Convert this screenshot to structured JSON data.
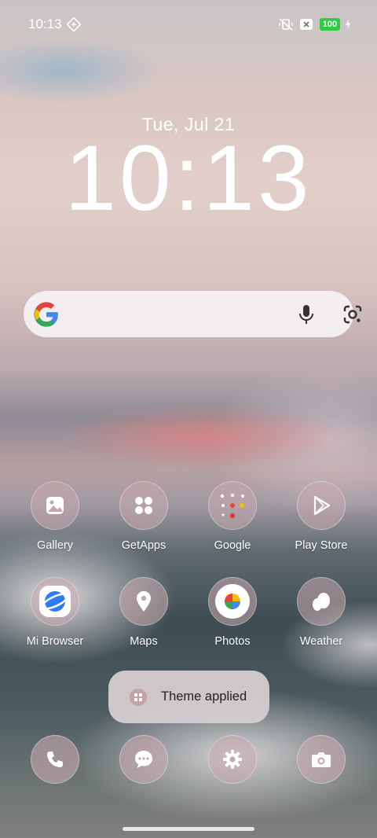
{
  "statusbar": {
    "time": "10:13",
    "battery": "100",
    "icons": [
      "data-saver-icon",
      "mute-icon",
      "sim-x-icon",
      "charging-icon"
    ],
    "battery_color": "#2ecc40"
  },
  "lockscreen": {
    "date": "Tue, Jul 21",
    "clock": "10:13"
  },
  "search": {
    "icons": [
      "google-g-icon",
      "microphone-icon",
      "google-lens-icon"
    ]
  },
  "apps": {
    "gallery": "Gallery",
    "getapps": "GetApps",
    "google": "Google",
    "playstore": "Play Store",
    "browser": "Mi Browser",
    "maps": "Maps",
    "photos": "Photos",
    "weather": "Weather"
  },
  "dock": {
    "icons": [
      "phone-icon",
      "messages-icon",
      "settings-icon",
      "camera-icon"
    ]
  },
  "toast": {
    "text": "Theme applied"
  }
}
